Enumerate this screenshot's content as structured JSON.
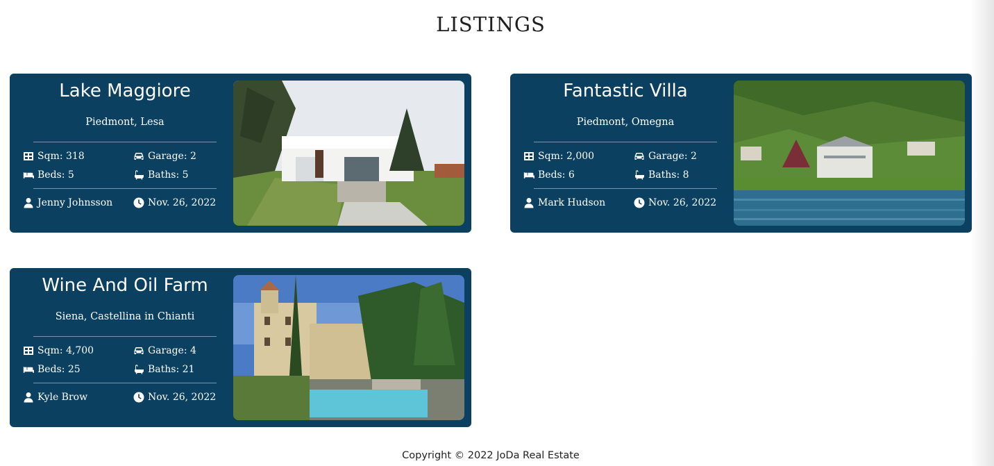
{
  "page": {
    "title": "LISTINGS",
    "footer": "Copyright © 2022 JoDa Real Estate"
  },
  "colors": {
    "card_background": "#0b4061",
    "card_text": "#ffffff",
    "page_background": "#ffffff"
  },
  "icons": {
    "sqm": "table-grid-icon",
    "garage": "car-icon",
    "beds": "bed-icon",
    "baths": "bath-icon",
    "agent": "user-icon",
    "date": "clock-icon"
  },
  "listings": [
    {
      "title": "Lake Maggiore",
      "location": "Piedmont, Lesa",
      "sqm": "Sqm: 318",
      "garage": "Garage: 2",
      "beds": "Beds: 5",
      "baths": "Baths: 5",
      "agent": "Jenny Johnsson",
      "date": "Nov. 26, 2022",
      "photo": "modern white villa with lawn"
    },
    {
      "title": "Fantastic Villa",
      "location": "Piedmont, Omegna",
      "sqm": "Sqm: 2,000",
      "garage": "Garage: 2",
      "beds": "Beds: 6",
      "baths": "Baths: 8",
      "agent": "Mark Hudson",
      "date": "Nov. 26, 2022",
      "photo": "lakeside villa on forested hill"
    },
    {
      "title": "Wine And Oil Farm",
      "location": "Siena, Castellina in Chianti",
      "sqm": "Sqm: 4,700",
      "garage": "Garage: 4",
      "beds": "Beds: 25",
      "baths": "Baths: 21",
      "agent": "Kyle Brow",
      "date": "Nov. 26, 2022",
      "photo": "tuscan estate with cypress and pool"
    }
  ]
}
